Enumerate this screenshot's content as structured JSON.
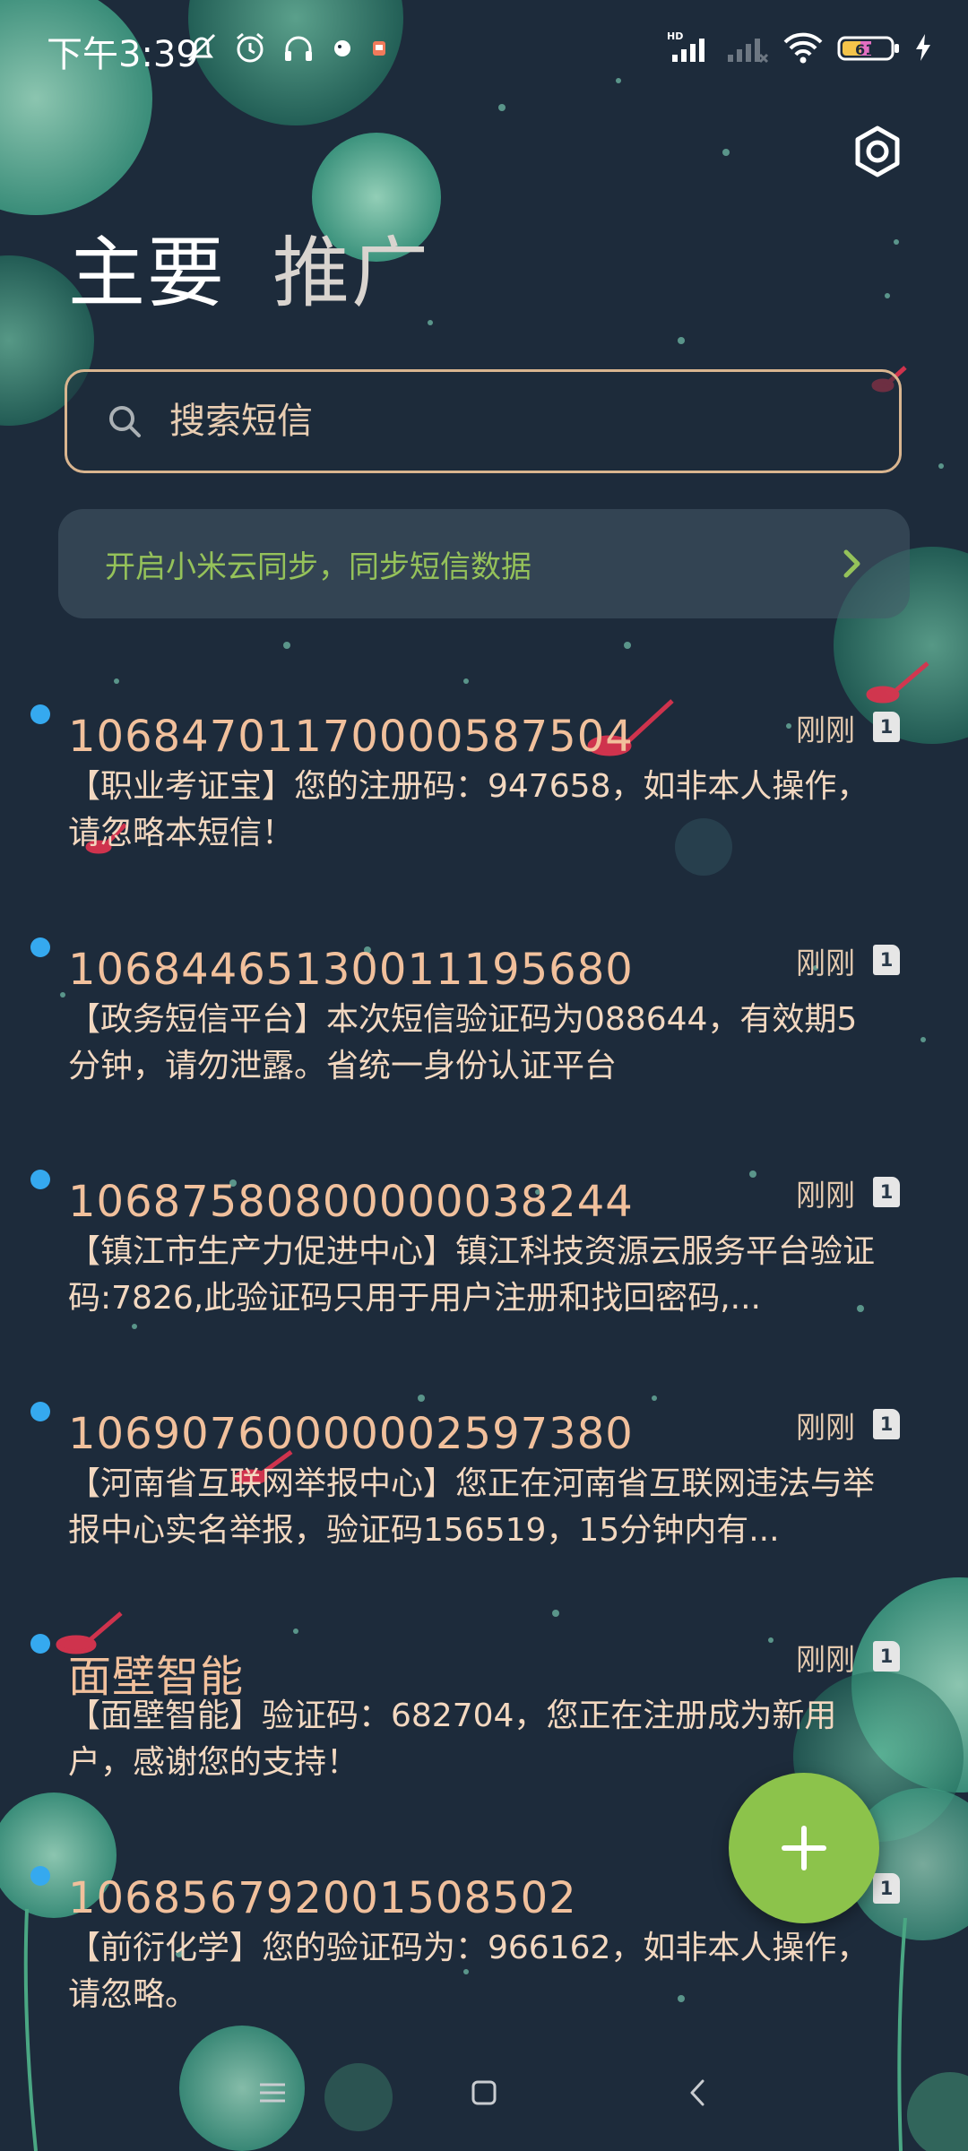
{
  "status_bar": {
    "time": "下午3:39",
    "battery": "61"
  },
  "tabs": [
    {
      "label": "主要"
    },
    {
      "label": "推广"
    }
  ],
  "search": {
    "placeholder": "搜索短信"
  },
  "sync_banner": {
    "text": "开启小米云同步，同步短信数据"
  },
  "messages": [
    {
      "sender": "1068470117000058750​4",
      "time": "刚刚",
      "sim": "1",
      "body": "【职业考证宝】您的注册码：947658，如非本人操作，请忽略本短信！",
      "unread": true
    },
    {
      "sender": "10684465130011195680",
      "time": "刚刚",
      "sim": "1",
      "body": "【政务短信平台】本次短信验证码为088644，有效期5分钟，请勿泄露。省统一身份认证平台",
      "unread": true
    },
    {
      "sender": "10687580800000038244",
      "time": "刚刚",
      "sim": "1",
      "body": "【镇江市生产力促进中心】镇江科技资源云服务平台验证码:7826,此验证码只用于用户注册和找回密码,...",
      "unread": true
    },
    {
      "sender": "10690760000002597380",
      "time": "刚刚",
      "sim": "1",
      "body": "【河南省互联网举报中心】您正在河南省互联网违法与举报中心实名举报，验证码156519，15分钟内有...",
      "unread": true
    },
    {
      "sender": "面壁智能",
      "time": "刚刚",
      "sim": "1",
      "body": "【面壁智能】验证码：682704，您正在注册成为新用户，感谢您的支持！",
      "unread": true
    },
    {
      "sender": "106856792001508502",
      "time": "",
      "sim": "1",
      "body": "【前衍化学】您的验证码为：966162，如非本人操作，请忽略。",
      "unread": true
    }
  ],
  "colors": {
    "background": "#1d2b3b",
    "unread_dot": "#35a9ef",
    "fab": "#8cc34b",
    "sync_text": "#95c25a",
    "search_border": "#d9b58f"
  },
  "icons": {
    "settings": "gear-icon",
    "search": "search-icon",
    "chevron": "chevron-right-icon",
    "fab": "plus-icon"
  }
}
